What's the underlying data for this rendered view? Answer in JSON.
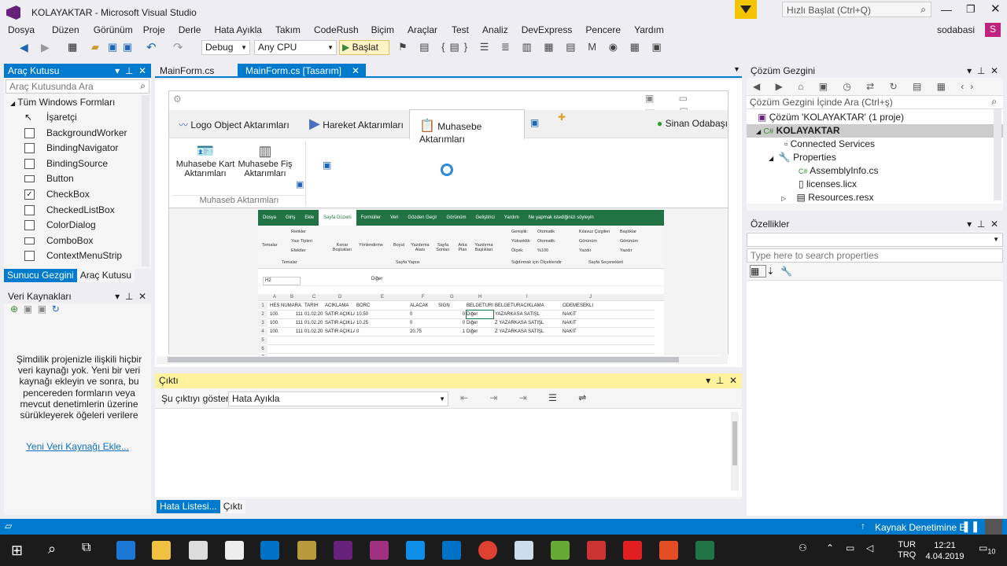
{
  "window": {
    "title": "KOLAYAKTAR - Microsoft Visual Studio",
    "quick_launch": "Hızlı Başlat (Ctrl+Q)",
    "user": "sodabasi",
    "user_initial": "S"
  },
  "menu": [
    "Dosya",
    "Düzen",
    "Görünüm",
    "Proje",
    "Derle",
    "Hata Ayıkla",
    "Takım",
    "CodeRush",
    "Biçim",
    "Araçlar",
    "Test",
    "Analiz",
    "DevExpress",
    "Pencere",
    "Yardım"
  ],
  "toolbar": {
    "config": "Debug",
    "platform": "Any CPU",
    "start": "Başlat"
  },
  "toolbox": {
    "title": "Araç Kutusu",
    "search_placeholder": "Araç Kutusunda Ara",
    "group": "Tüm Windows Formları",
    "items": [
      "İşaretçi",
      "BackgroundWorker",
      "BindingNavigator",
      "BindingSource",
      "Button",
      "CheckBox",
      "CheckedListBox",
      "ColorDialog",
      "ComboBox",
      "ContextMenuStrip"
    ],
    "tabs": [
      "Sunucu Gezgini",
      "Araç Kutusu"
    ]
  },
  "datasources": {
    "title": "Veri Kaynakları",
    "message": "Şimdilik projenizle ilişkili hiçbir veri kaynağı yok. Yeni bir veri kaynağı ekleyin ve sonra, bu pencereden formların veya mevcut denetimlerin üzerine sürükleyerek öğeleri verilere",
    "link": "Yeni Veri Kaynağı Ekle..."
  },
  "doc_tabs": [
    "MainForm.cs",
    "MainForm.cs [Tasarım]"
  ],
  "designer": {
    "tabs": [
      "Logo Object Aktarımları",
      "Hareket Aktarımları",
      "Muhasebe Aktarımları"
    ],
    "room": "Sinan Odabaşı",
    "buttons": [
      "Muhasebe Kart Aktarımları",
      "Muhasebe Fiş Aktarımları"
    ],
    "group": "Muhaseb Aktarımları"
  },
  "excel": {
    "tabs": [
      "Dosya",
      "Giriş",
      "Ekle",
      "Sayfa Düzeni",
      "Formüller",
      "Veri",
      "Gözden Geçir",
      "Görünüm",
      "Geliştirici",
      "Yardım",
      "Ne yapmak istediğinizi söyleyin"
    ],
    "groups": [
      "Temalar",
      "Sayfa Yapısı",
      "Sığdırmak için Ölçeklendir",
      "Sayfa Seçenekleri"
    ],
    "ribbon_items": [
      "Temalar",
      "Renkler",
      "Yazı Tipleri",
      "Efektler",
      "Kenar Boşlukları",
      "Yönlendirme",
      "Boyut",
      "Yazdırma Alanı",
      "Sayfa Sonları",
      "Arka Plan",
      "Yazdırma Başlıkları",
      "Genişlik:",
      "Yükseklik:",
      "Ölçek:",
      "Otomatik",
      "Otomatik",
      "%100",
      "Kılavuz Çizgileri",
      "Görünüm",
      "Yazdır",
      "Başlıklar",
      "Görünüm",
      "Yazdır"
    ],
    "namebox": "H2",
    "formula": "Diğer",
    "cols": [
      "A",
      "B",
      "C",
      "D",
      "E",
      "F",
      "G",
      "H",
      "I",
      "J"
    ],
    "rows": [
      [
        "HESAP",
        "NUMARA",
        "TARIH",
        "ACIKLAMA",
        "BORC",
        "ALACAK",
        "SIGN",
        "BELGETURU",
        "BELGETURACIKLAMA",
        "ODEMESEKLI"
      ],
      [
        "100.1.1",
        "111",
        "01.02.2018",
        "SATIR AÇIKLAMASI",
        "10.50",
        "0",
        "0",
        "Diğer",
        "YAZARKASA SATIŞL",
        "NAKIT"
      ],
      [
        "100.1.1",
        "111",
        "01.02.2018",
        "SATIR AÇIKLAMASI",
        "10.25",
        "0",
        "0",
        "Diğer",
        "Z YAZARKASA SATIŞL",
        "NAKIT"
      ],
      [
        "100.1.1",
        "111",
        "01.02.2018",
        "SATIR AÇIKLAMASI",
        "0",
        "20.75",
        "1",
        "Diğer",
        "Z YAZARKASA SATIŞL",
        "NAKIT"
      ]
    ]
  },
  "output": {
    "title": "Çıktı",
    "show_label": "Şu çıktıyı göster:",
    "source": "Hata Ayıkla",
    "tabs": [
      "Hata Listesi...",
      "Çıktı"
    ]
  },
  "solution": {
    "title": "Çözüm Gezgini",
    "search_placeholder": "Çözüm Gezgini İçinde Ara (Ctrl+ş)",
    "items": [
      "Çözüm 'KOLAYAKTAR' (1 proje)",
      "KOLAYAKTAR",
      "Connected Services",
      "Properties",
      "AssemblyInfo.cs",
      "licenses.licx",
      "Resources.resx"
    ]
  },
  "properties": {
    "title": "Özellikler",
    "search_placeholder": "Type here to search properties"
  },
  "statusbar": {
    "text": "Kaynak Denetimine E"
  },
  "taskbar": {
    "lang": "TUR",
    "lang2": "TRQ",
    "time": "12:21",
    "date": "4.04.2019",
    "notif": "10"
  }
}
